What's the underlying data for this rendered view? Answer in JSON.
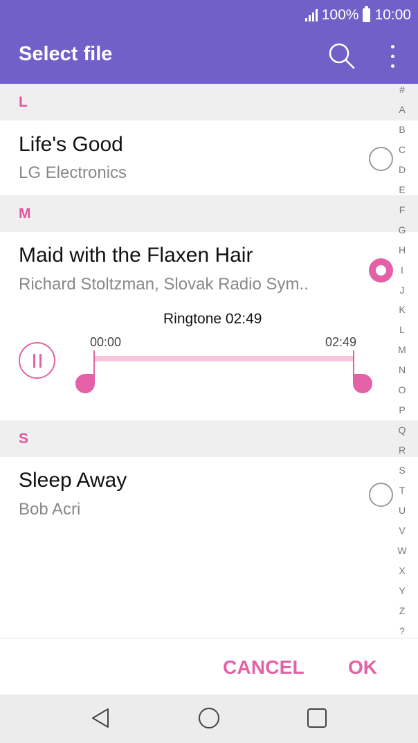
{
  "status_bar": {
    "battery": "100%",
    "time": "10:00"
  },
  "app_bar": {
    "title": "Select file"
  },
  "sections": [
    {
      "letter": "L",
      "items": [
        {
          "title": "Life's Good",
          "artist": "LG Electronics",
          "selected": false
        }
      ]
    },
    {
      "letter": "M",
      "items": [
        {
          "title": "Maid with the Flaxen Hair",
          "artist": "Richard Stoltzman, Slovak Radio Sym..",
          "selected": true
        }
      ]
    },
    {
      "letter": "S",
      "items": [
        {
          "title": "Sleep Away",
          "artist": "Bob Acri",
          "selected": false
        }
      ]
    }
  ],
  "player": {
    "caption": "Ringtone 02:49",
    "start_time": "00:00",
    "end_time": "02:49",
    "progress": 0.0
  },
  "index_letters": [
    "#",
    "A",
    "B",
    "C",
    "D",
    "E",
    "F",
    "G",
    "H",
    "I",
    "J",
    "K",
    "L",
    "M",
    "N",
    "O",
    "P",
    "Q",
    "R",
    "S",
    "T",
    "U",
    "V",
    "W",
    "X",
    "Y",
    "Z",
    "?"
  ],
  "actions": {
    "cancel_label": "CANCEL",
    "ok_label": "OK"
  },
  "colors": {
    "app_bar": "#7060c8",
    "accent": "#e461a7",
    "section_bg": "#efefef",
    "nav_bg": "#ececec"
  },
  "icons": {
    "search": "search-icon",
    "more": "more-vert-icon",
    "back": "nav-back-icon",
    "home": "nav-home-icon",
    "recent": "nav-recent-icon"
  }
}
